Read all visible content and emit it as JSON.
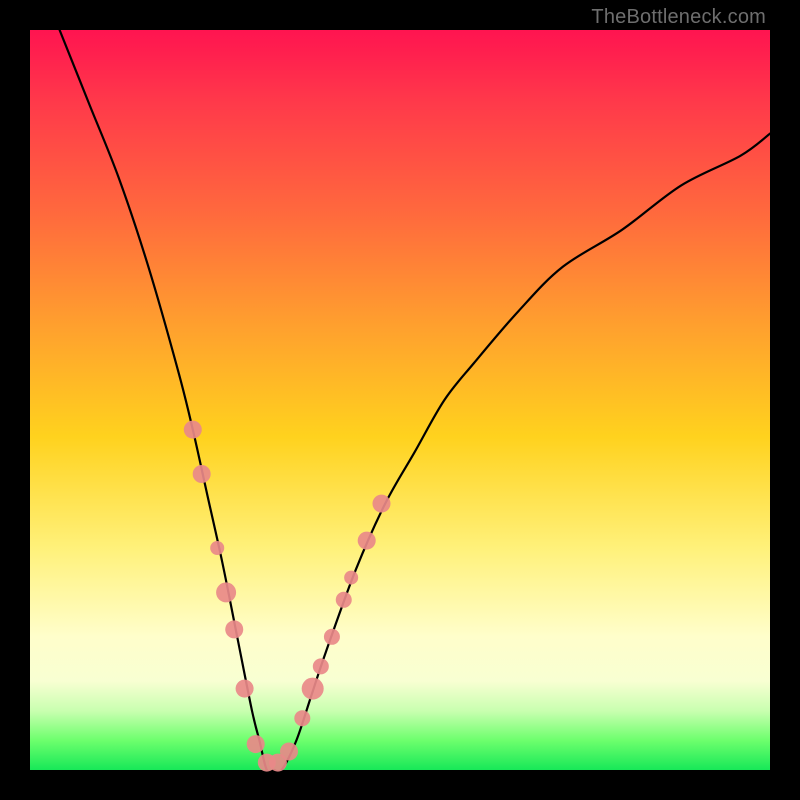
{
  "watermark": "TheBottleneck.com",
  "colors": {
    "top": "#ff1450",
    "mid": "#ffd21e",
    "bottom": "#17e858",
    "curve": "#000000",
    "marker": "#e98989",
    "frame": "#000000"
  },
  "chart_data": {
    "type": "line",
    "title": "",
    "xlabel": "",
    "ylabel": "",
    "xlim": [
      0,
      100
    ],
    "ylim": [
      0,
      100
    ],
    "grid": false,
    "legend": false,
    "series": [
      {
        "name": "bottleneck-curve",
        "x": [
          4,
          8,
          12,
          16,
          20,
          22,
          24,
          26,
          28,
          30,
          31,
          32,
          33,
          34,
          36,
          38,
          40,
          44,
          48,
          52,
          56,
          60,
          66,
          72,
          80,
          88,
          96,
          100
        ],
        "values": [
          100,
          90,
          80,
          68,
          54,
          46,
          37,
          28,
          18,
          8,
          4,
          0,
          0,
          0,
          4,
          10,
          16,
          27,
          36,
          43,
          50,
          55,
          62,
          68,
          73,
          79,
          83,
          86
        ]
      }
    ],
    "markers": {
      "left_branch": [
        {
          "x": 22.0,
          "y": 46,
          "r": 9
        },
        {
          "x": 23.2,
          "y": 40,
          "r": 9
        },
        {
          "x": 25.3,
          "y": 30,
          "r": 7
        },
        {
          "x": 26.5,
          "y": 24,
          "r": 10
        },
        {
          "x": 27.6,
          "y": 19,
          "r": 9
        },
        {
          "x": 29.0,
          "y": 11,
          "r": 9
        }
      ],
      "trough": [
        {
          "x": 30.5,
          "y": 3.5,
          "r": 9
        },
        {
          "x": 32.0,
          "y": 1.0,
          "r": 9
        },
        {
          "x": 33.5,
          "y": 1.0,
          "r": 9
        },
        {
          "x": 35.0,
          "y": 2.5,
          "r": 9
        }
      ],
      "right_branch": [
        {
          "x": 36.8,
          "y": 7,
          "r": 8
        },
        {
          "x": 38.2,
          "y": 11,
          "r": 11
        },
        {
          "x": 39.3,
          "y": 14,
          "r": 8
        },
        {
          "x": 40.8,
          "y": 18,
          "r": 8
        },
        {
          "x": 42.4,
          "y": 23,
          "r": 8
        },
        {
          "x": 43.4,
          "y": 26,
          "r": 7
        },
        {
          "x": 45.5,
          "y": 31,
          "r": 9
        },
        {
          "x": 47.5,
          "y": 36,
          "r": 9
        }
      ]
    }
  }
}
